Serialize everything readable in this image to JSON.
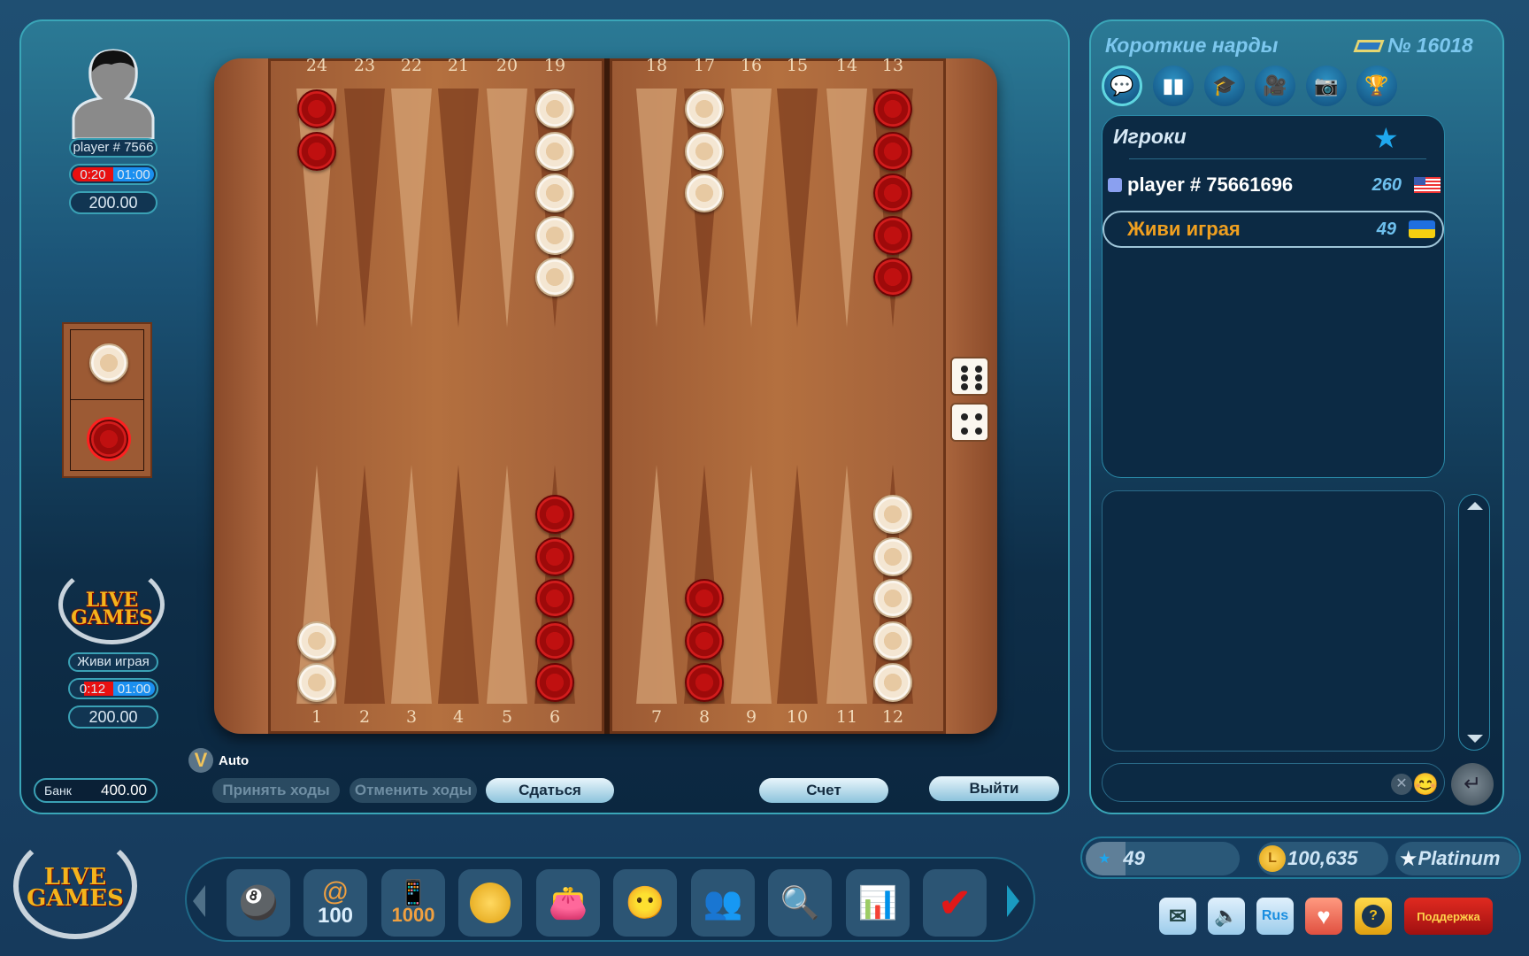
{
  "game": {
    "title": "Короткие нарды",
    "table_number": "№ 16018"
  },
  "opponent": {
    "name": "player # 7566",
    "timer_move": "0:20",
    "timer_total": "01:00",
    "stake": "200.00"
  },
  "me": {
    "name": "Живи играя",
    "timer_move": "0:12",
    "timer_total": "01:00",
    "stake": "200.00"
  },
  "bank": {
    "label": "Банк",
    "value": "400.00"
  },
  "auto_label": "Auto",
  "buttons": {
    "accept": "Принять ходы",
    "undo": "Отменить ходы",
    "resign": "Сдаться",
    "score": "Счет",
    "exit": "Выйти"
  },
  "board": {
    "top_points": [
      "24",
      "23",
      "22",
      "21",
      "20",
      "19",
      "18",
      "17",
      "16",
      "15",
      "14",
      "13"
    ],
    "bottom_points": [
      "1",
      "2",
      "3",
      "4",
      "5",
      "6",
      "7",
      "8",
      "9",
      "10",
      "11",
      "12"
    ],
    "checkers": [
      {
        "point": 24,
        "color": "red",
        "count": 2
      },
      {
        "point": 19,
        "color": "white",
        "count": 5
      },
      {
        "point": 17,
        "color": "white",
        "count": 3
      },
      {
        "point": 13,
        "color": "red",
        "count": 5
      },
      {
        "point": 1,
        "color": "white",
        "count": 2
      },
      {
        "point": 6,
        "color": "red",
        "count": 5
      },
      {
        "point": 8,
        "color": "red",
        "count": 3
      },
      {
        "point": 12,
        "color": "white",
        "count": 5
      }
    ],
    "dice": [
      6,
      4
    ],
    "bar_colors": {
      "top": "white",
      "bottom": "red"
    }
  },
  "tabs": [
    {
      "icon": "chat-icon"
    },
    {
      "icon": "stats-icon"
    },
    {
      "icon": "table-icon"
    },
    {
      "icon": "video-icon"
    },
    {
      "icon": "camera-icon"
    },
    {
      "icon": "trophy-icon"
    }
  ],
  "players_panel": {
    "title": "Игроки",
    "players": [
      {
        "name": "player # 75661696",
        "rating": "260",
        "flag": "us"
      },
      {
        "name": "Живи играя",
        "rating": "49",
        "flag": "ua"
      }
    ]
  },
  "status": {
    "level": "49",
    "coins": "100,635",
    "rank": "Platinum"
  },
  "bottom_buttons": {
    "language": "Rus",
    "support": "Поддержка"
  },
  "toolbar": [
    "games-icon",
    "at-100-icon",
    "1000-phone-icon",
    "coin-clock-icon",
    "wallet-icon",
    "chat-faces-icon",
    "players-icon",
    "search-player-icon",
    "chart-icon",
    "checkmark-icon"
  ],
  "toolbar_labels": {
    "at": "@",
    "n100": "100",
    "n1000": "1000"
  },
  "logo_text": "LIVE GAMES",
  "colors": {
    "accent": "#3aa6b8",
    "red_checker": "#c01010",
    "white_checker": "#f4e6d2",
    "orange_name": "#f0a020"
  }
}
